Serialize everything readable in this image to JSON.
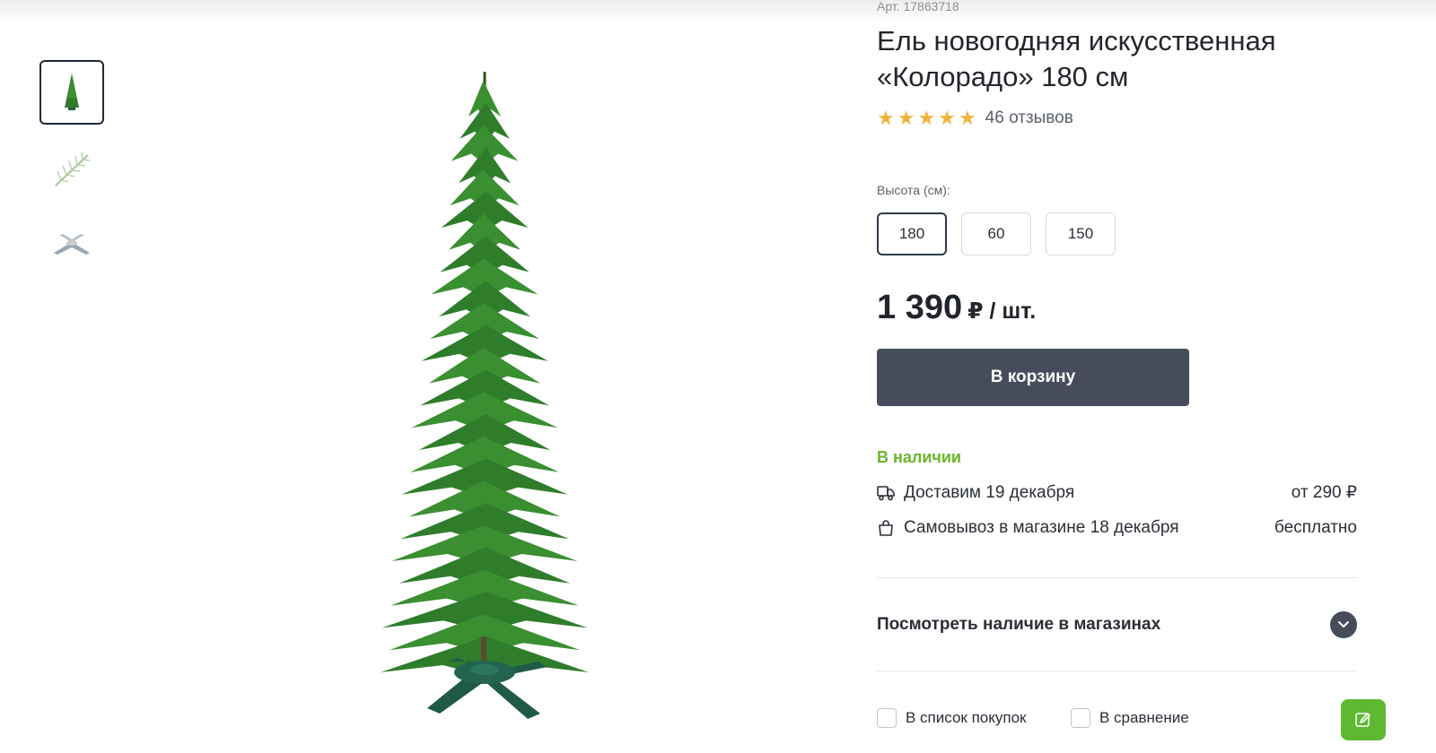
{
  "product": {
    "sku": "Арт. 17863718",
    "title": "Ель новогодняя искусственная «Колорадо» 180 см",
    "rating_stars": 5,
    "reviews": "46 отзывов"
  },
  "gallery": {
    "thumbnails": [
      {
        "icon": "tree-thumbnail-icon"
      },
      {
        "icon": "branch-thumbnail-icon"
      },
      {
        "icon": "stand-thumbnail-icon"
      }
    ],
    "main_image": "christmas-tree-image"
  },
  "height": {
    "label": "Высота (см):",
    "options": [
      "180",
      "60",
      "150"
    ],
    "selected": "180"
  },
  "price": {
    "value": "1 390",
    "unit": "₽ / шт."
  },
  "cart_button": "В корзину",
  "availability": {
    "status": "В наличии",
    "status_color": "#6bb52c",
    "delivery": {
      "icon": "truck-icon",
      "text": "Доставим 19 декабря",
      "cost": "от 290 ₽"
    },
    "pickup": {
      "icon": "bag-icon",
      "text": "Самовывоз в магазине 18 декабря",
      "cost": "бесплатно"
    }
  },
  "stores_toggle": "Посмотреть наличие в магазинах",
  "actions": {
    "shopping_list": "В список покупок",
    "compare": "В сравнение"
  },
  "colors": {
    "button": "#464c5b",
    "fab": "#5fb832",
    "star": "#f0b43c"
  }
}
